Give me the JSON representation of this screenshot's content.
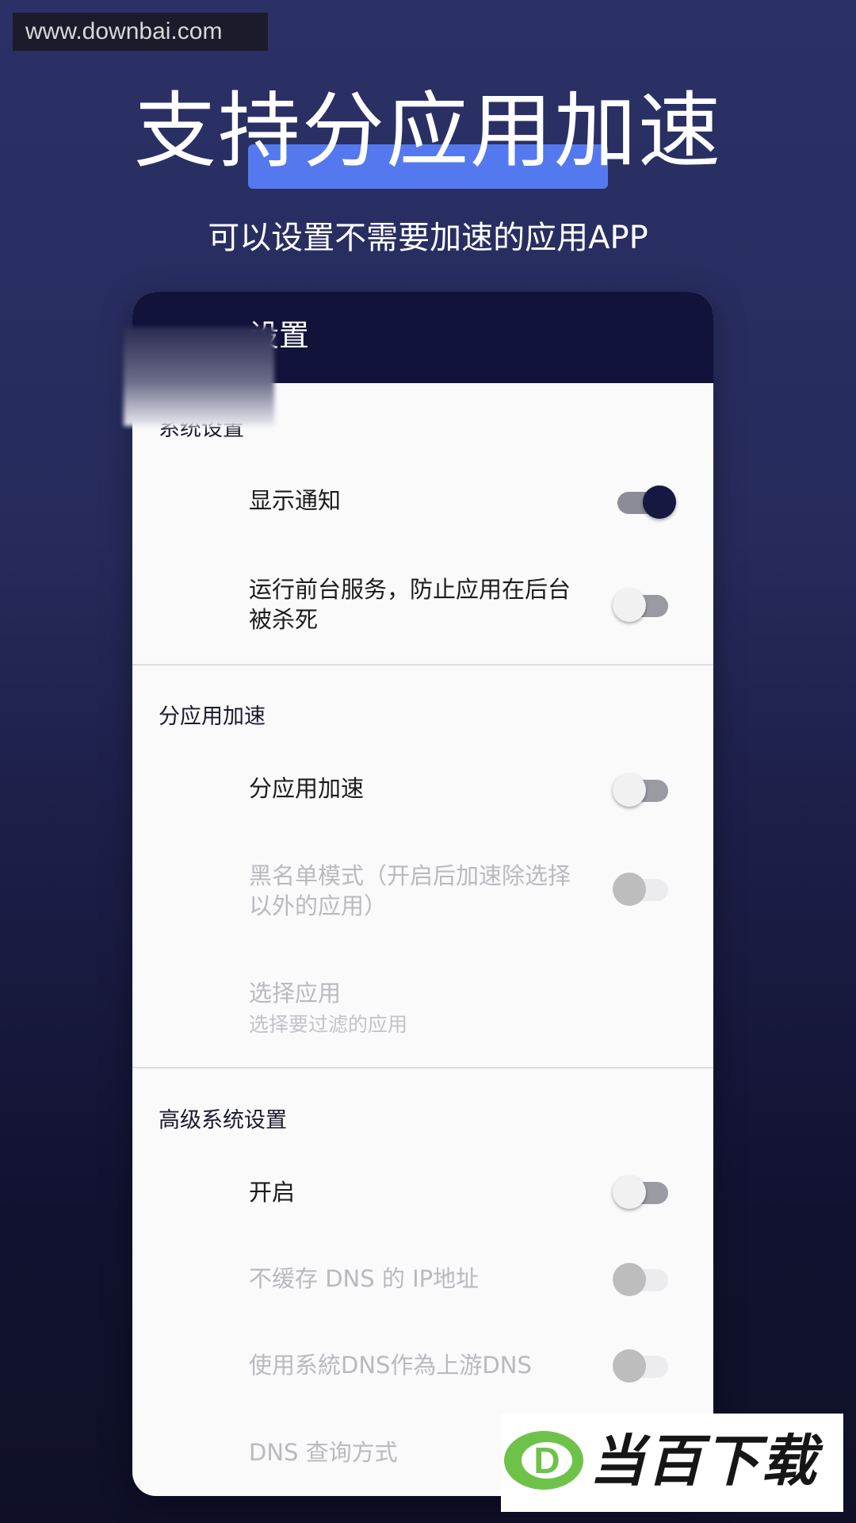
{
  "watermark": {
    "text": "www.downbai.com"
  },
  "hero": {
    "title": "支持分应用加速",
    "subtitle": "可以设置不需要加速的应用APP",
    "highlight_color": "#5478ee"
  },
  "appbar": {
    "title": "设置",
    "back_icon": "back-arrow-icon"
  },
  "sections": {
    "system": {
      "header": "系统设置",
      "items": [
        {
          "label": "显示通知",
          "switch": "on"
        },
        {
          "label": "运行前台服务，防止应用在后台被杀死",
          "switch": "off"
        }
      ]
    },
    "per_app": {
      "header": "分应用加速",
      "items": [
        {
          "label": "分应用加速",
          "switch": "off"
        },
        {
          "label": "黑名单模式（开启后加速除选择以外的应用）",
          "switch": "disabled"
        },
        {
          "label": "选择应用",
          "summary": "选择要过滤的应用"
        }
      ]
    },
    "advanced": {
      "header": "高级系统设置",
      "items": [
        {
          "label": "开启",
          "switch": "off"
        },
        {
          "label": "不缓存 DNS 的 IP地址",
          "switch": "disabled"
        },
        {
          "label": "使用系統DNS作為上游DNS",
          "switch": "disabled"
        },
        {
          "label": "DNS 查询方式"
        }
      ]
    }
  },
  "brand_logo": {
    "letter": "D",
    "text": "当百下载",
    "color": "#6ec24a"
  },
  "colors": {
    "accent": "#161842",
    "appbar": "#12133a",
    "panel": "#fafafb"
  }
}
